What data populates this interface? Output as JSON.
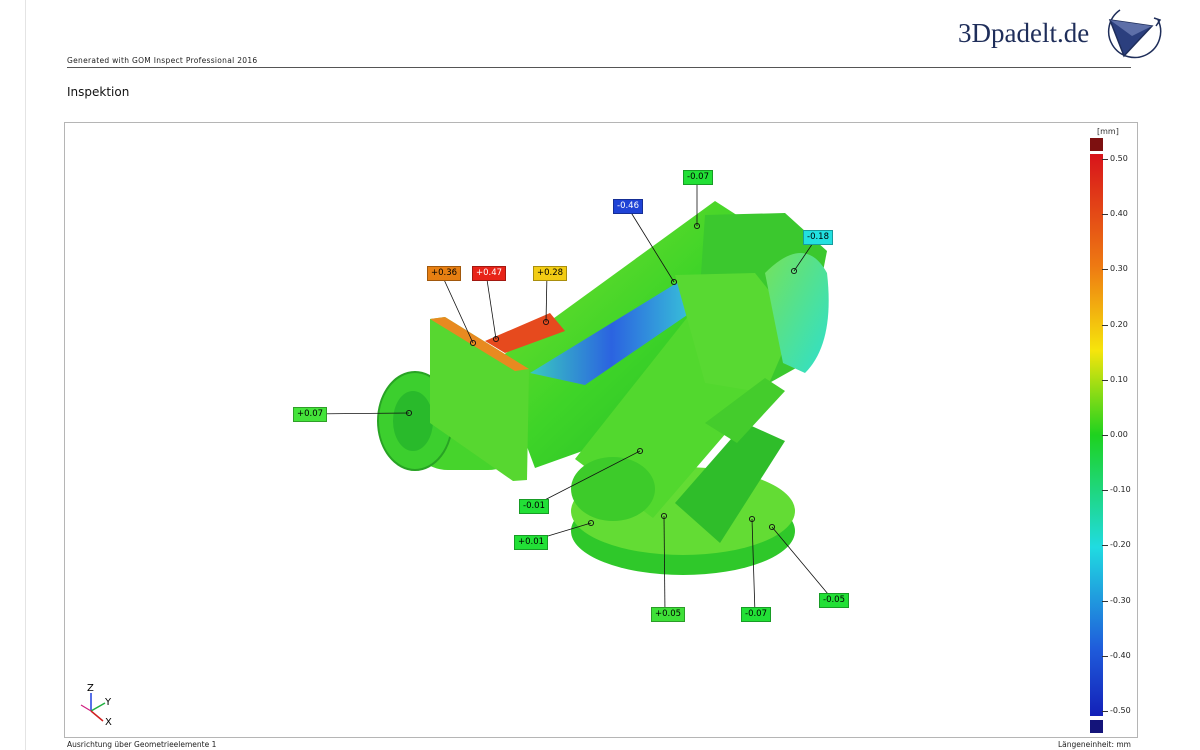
{
  "header": {
    "generated": "Generated with GOM Inspect Professional 2016",
    "logo_text": "3Dpadelt.de"
  },
  "section_title": "Inspektion",
  "colorbar": {
    "unit": "[mm]",
    "ticks": [
      "0.50",
      "0.40",
      "0.30",
      "0.20",
      "0.10",
      "0.00",
      "-0.10",
      "-0.20",
      "-0.30",
      "-0.40",
      "-0.50"
    ]
  },
  "deviation_labels": [
    {
      "name": "label-minus-0-07-top",
      "text": "-0.07",
      "color": "#22e036"
    },
    {
      "name": "label-minus-0-46",
      "text": "-0.46",
      "color": "#1f43d6"
    },
    {
      "name": "label-minus-0-18",
      "text": "-0.18",
      "color": "#22e0e0"
    },
    {
      "name": "label-plus-0-36",
      "text": "+0.36",
      "color": "#e77f12"
    },
    {
      "name": "label-plus-0-47",
      "text": "+0.47",
      "color": "#e82318"
    },
    {
      "name": "label-plus-0-28",
      "text": "+0.28",
      "color": "#f2cc14"
    },
    {
      "name": "label-plus-0-07",
      "text": "+0.07",
      "color": "#44e43a"
    },
    {
      "name": "label-minus-0-01",
      "text": "-0.01",
      "color": "#22e036"
    },
    {
      "name": "label-plus-0-01",
      "text": "+0.01",
      "color": "#22e036"
    },
    {
      "name": "label-plus-0-05",
      "text": "+0.05",
      "color": "#3ee038"
    },
    {
      "name": "label-minus-0-07-bottom",
      "text": "-0.07",
      "color": "#22e036"
    },
    {
      "name": "label-minus-0-05",
      "text": "-0.05",
      "color": "#22e036"
    }
  ],
  "axes": {
    "z": "Z",
    "y": "Y",
    "x": "X"
  },
  "footer": {
    "alignment": "Ausrichtung über Geometrieelemente 1",
    "unit": "Längeneinheit: mm"
  }
}
